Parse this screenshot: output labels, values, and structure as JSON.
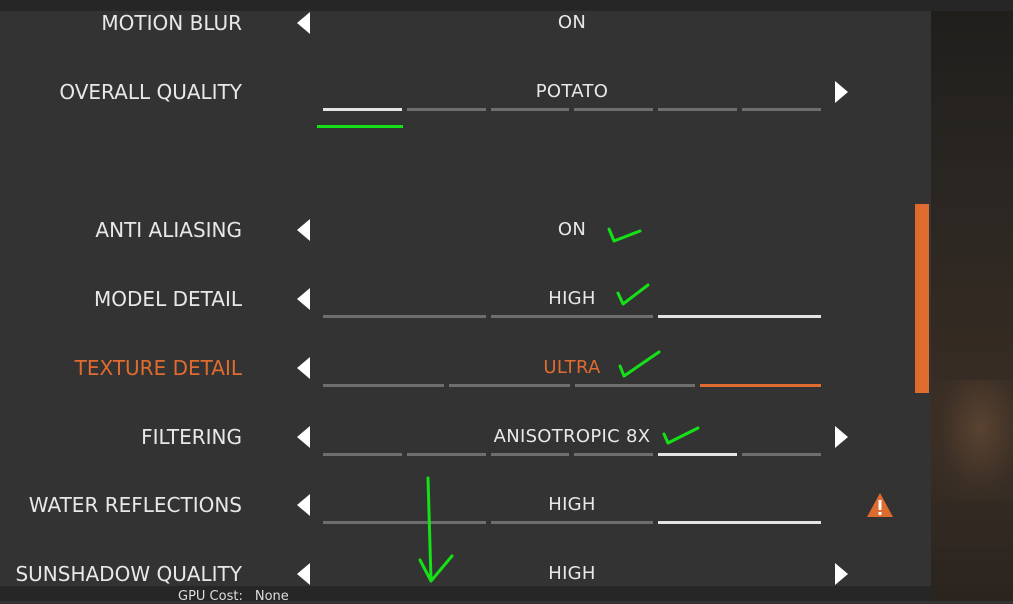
{
  "settings": [
    {
      "label": "MOTION BLUR",
      "value": "ON"
    },
    {
      "label": "OVERALL QUALITY",
      "value": "POTATO"
    },
    {
      "label": "ANTI ALIASING",
      "value": "ON"
    },
    {
      "label": "MODEL DETAIL",
      "value": "HIGH"
    },
    {
      "label": "TEXTURE DETAIL",
      "value": "ULTRA"
    },
    {
      "label": "FILTERING",
      "value": "ANISOTROPIC 8X"
    },
    {
      "label": "WATER REFLECTIONS",
      "value": "HIGH"
    },
    {
      "label": "SUNSHADOW QUALITY",
      "value": "HIGH"
    }
  ],
  "footer": {
    "gpu_cost_label": "GPU Cost:",
    "gpu_cost_value": "None"
  },
  "colors": {
    "accent": "#e06b2f",
    "annotation": "#16e016",
    "background": "#333333"
  },
  "icons": {
    "warning": "warning-triangle-icon",
    "left": "arrow-left-icon",
    "right": "arrow-right-icon"
  }
}
